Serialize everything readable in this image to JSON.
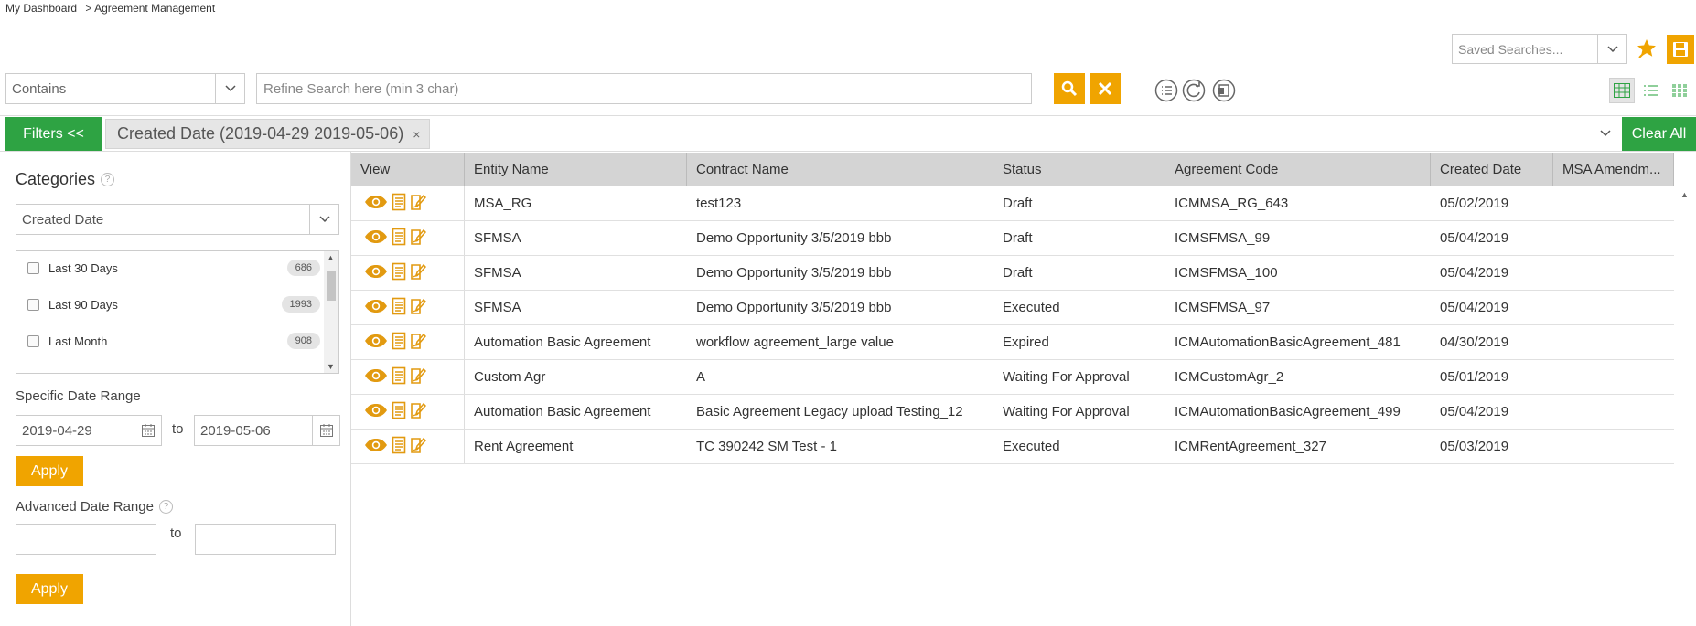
{
  "breadcrumb": {
    "home": "My Dashboard",
    "current": "> Agreement Management"
  },
  "saved_searches": {
    "placeholder": "Saved Searches..."
  },
  "search": {
    "operator": "Contains",
    "placeholder": "Refine Search here (min 3 char)"
  },
  "filterbar": {
    "filters_label": "Filters <<",
    "chip_label": "Created Date (2019-04-29 2019-05-06)",
    "chip_close": "×",
    "clear_all_label": "Clear All"
  },
  "categories": {
    "title": "Categories",
    "help": "?",
    "selected": "Created Date",
    "items": [
      {
        "label": "Last 30 Days",
        "count": "686"
      },
      {
        "label": "Last 90 Days",
        "count": "1993"
      },
      {
        "label": "Last Month",
        "count": "908"
      }
    ]
  },
  "specific_range": {
    "label": "Specific Date Range",
    "from": "2019-04-29",
    "to_label": "to",
    "to": "2019-05-06",
    "apply_label": "Apply"
  },
  "advanced_range": {
    "label": "Advanced Date Range",
    "help": "?",
    "to_label": "to",
    "apply_label": "Apply"
  },
  "grid": {
    "columns": [
      "View",
      "Entity Name",
      "Contract Name",
      "Status",
      "Agreement Code",
      "Created Date",
      "MSA Amendm..."
    ],
    "rows": [
      {
        "entity": "MSA_RG",
        "contract": "test123",
        "status": "Draft",
        "code": "ICMMSA_RG_643",
        "created": "05/02/2019"
      },
      {
        "entity": "SFMSA",
        "contract": "Demo Opportunity 3/5/2019 bbb",
        "status": "Draft",
        "code": "ICMSFMSA_99",
        "created": "05/04/2019"
      },
      {
        "entity": "SFMSA",
        "contract": "Demo Opportunity 3/5/2019 bbb",
        "status": "Draft",
        "code": "ICMSFMSA_100",
        "created": "05/04/2019"
      },
      {
        "entity": "SFMSA",
        "contract": "Demo Opportunity 3/5/2019 bbb",
        "status": "Executed",
        "code": "ICMSFMSA_97",
        "created": "05/04/2019"
      },
      {
        "entity": "Automation Basic Agreement",
        "contract": "workflow agreement_large value",
        "status": "Expired",
        "code": "ICMAutomationBasicAgreement_481",
        "created": "04/30/2019"
      },
      {
        "entity": "Custom Agr",
        "contract": "A",
        "status": "Waiting For Approval",
        "code": "ICMCustomAgr_2",
        "created": "05/01/2019"
      },
      {
        "entity": "Automation Basic Agreement",
        "contract": "Basic Agreement Legacy upload Testing_12",
        "status": "Waiting For Approval",
        "code": "ICMAutomationBasicAgreement_499",
        "created": "05/04/2019"
      },
      {
        "entity": "Rent Agreement",
        "contract": "TC 390242 SM Test - 1",
        "status": "Executed",
        "code": "ICMRentAgreement_327",
        "created": "05/03/2019"
      }
    ]
  },
  "colors": {
    "accent": "#f0a400",
    "green": "#2ea343",
    "header_bg": "#d4d4d4"
  },
  "icons": [
    "chevron-down-icon",
    "star-icon",
    "save-icon",
    "search-icon",
    "close-icon",
    "list-icon",
    "refresh-icon",
    "export-icon",
    "grid-view-icon",
    "list-view-icon",
    "tile-view-icon",
    "calendar-icon",
    "eye-icon",
    "document-icon",
    "amendment-icon"
  ]
}
